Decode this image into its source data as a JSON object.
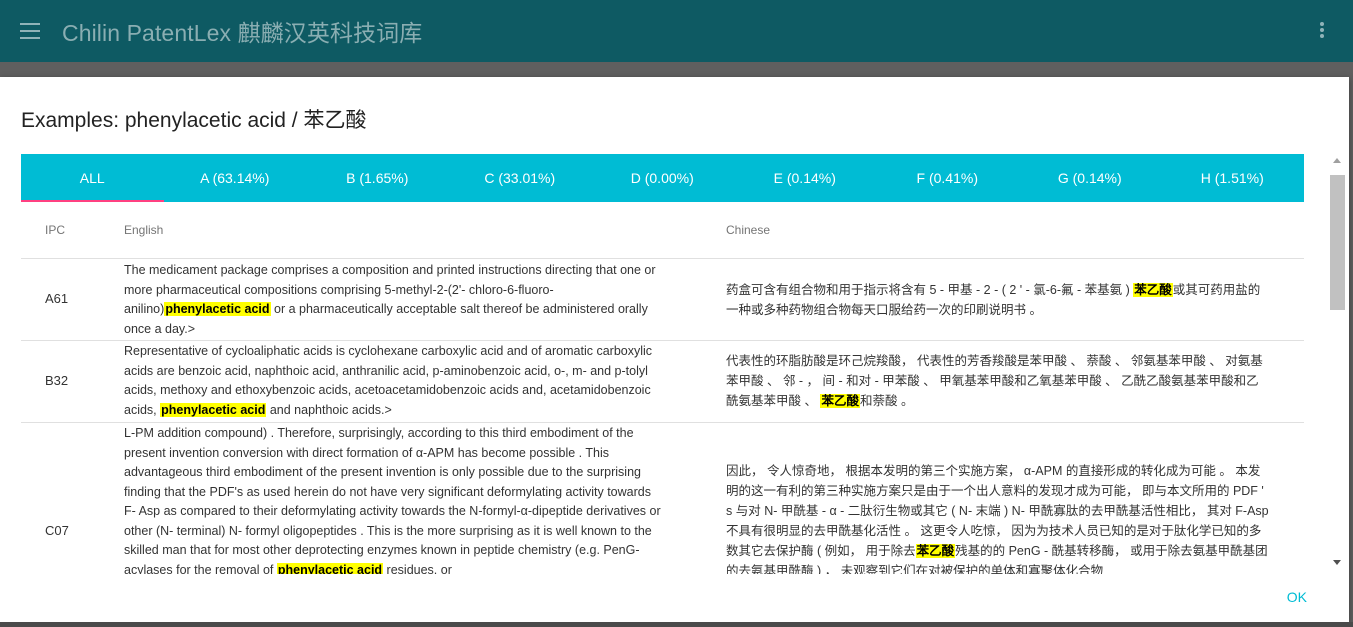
{
  "app": {
    "title": "Chilin PatentLex 麒麟汉英科技词库",
    "menu_icon": "hamburger-menu-icon",
    "more_icon": "more-vert-icon"
  },
  "dialog": {
    "title": "Examples: phenylacetic acid / 苯乙酸",
    "ok_label": "OK"
  },
  "tabs": [
    {
      "label": "ALL",
      "active": true
    },
    {
      "label": "A (63.14%)"
    },
    {
      "label": "B (1.65%)"
    },
    {
      "label": "C (33.01%)"
    },
    {
      "label": "D (0.00%)"
    },
    {
      "label": "E (0.14%)"
    },
    {
      "label": "F (0.41%)"
    },
    {
      "label": "G (0.14%)"
    },
    {
      "label": "H (1.51%)"
    }
  ],
  "table": {
    "headers": {
      "ipc": "IPC",
      "english": "English",
      "chinese": "Chinese"
    },
    "rows": [
      {
        "ipc": "A61",
        "en_before": "The medicament package comprises a composition and printed instructions directing that one or more pharmaceutical compositions comprising 5-methyl-2-(2'- chloro-6-fluoro-anilino)",
        "en_highlight": "phenylacetic acid",
        "en_after": " or a pharmaceutically acceptable salt thereof be administered orally once a day.>",
        "zh_before": "药盒可含有组合物和用于指示将含有 5 - 甲基 - 2 - ( 2 ' - 氯-6-氟 - 苯基氨 ) ",
        "zh_highlight": "苯乙酸",
        "zh_after": "或其可药用盐的一种或多种药物组合物每天口服给药一次的印刷说明书 。"
      },
      {
        "ipc": "B32",
        "en_before": "Representative of cycloaliphatic acids is cyclohexane carboxylic acid and of aromatic carboxylic acids are benzoic acid, naphthoic acid, anthranilic acid, p-aminobenzoic acid, o-, m- and p-tolyl acids, methoxy and ethoxybenzoic acids, acetoacetamidobenzoic acids and, acetamidobenzoic acids, ",
        "en_highlight": "phenylacetic acid",
        "en_after": " and naphthoic acids.>",
        "zh_before": "代表性的环脂肪酸是环己烷羧酸， 代表性的芳香羧酸是苯甲酸 、 萘酸 、 邻氨基苯甲酸 、 对氨基苯甲酸 、 邻 - ， 间 - 和对 - 甲苯酸 、 甲氧基苯甲酸和乙氧基苯甲酸 、 乙酰乙酸氨基苯甲酸和乙酰氨基苯甲酸 、 ",
        "zh_highlight": "苯乙酸",
        "zh_after": "和萘酸 。"
      },
      {
        "ipc": "C07",
        "en_before": "L-PM addition compound) . Therefore, surprisingly, according to this third embodiment of the present invention conversion with direct formation of α-APM has become possible . This advantageous third embodiment of the present invention is only possible due to the surprising finding that the PDF's as used herein do not have very significant deformylating activity towards F- Asp as compared to their deformylating activity towards the N-formyl-α-dipeptide derivatives or other (N- terminal) N- formyl oligopeptides . This is the more surprising as it is well known to the skilled man that for most other deprotecting enzymes known in peptide chemistry (e.g. PenG-acylases for the removal of ",
        "en_highlight": "phenylacetic acid",
        "en_after": " residues, or",
        "zh_before": "因此， 令人惊奇地， 根据本发明的第三个实施方案， α-APM 的直接形成的转化成为可能 。 本发明的这一有利的第三种实施方案只是由于一个出人意料的发现才成为可能， 即与本文所用的 PDF ' s 与对 N- 甲酰基 - α - 二肽衍生物或其它 ( N- 末端 ) N- 甲酰寡肽的去甲酰基活性相比， 其对 F-Asp 不具有很明显的去甲酰基化活性 。 这更令人吃惊， 因为为技术人员已知的是对于肽化学已知的多数其它去保护酶 ( 例如， 用于除去",
        "zh_highlight": "苯乙酸",
        "zh_after": "残基的的 PenG - 酰基转移酶， 或用于除去氨基甲酰基团的去氨基甲酰酶 ) ， 未观察到它们在对被保护的单体和寡聚体化合物"
      }
    ]
  }
}
